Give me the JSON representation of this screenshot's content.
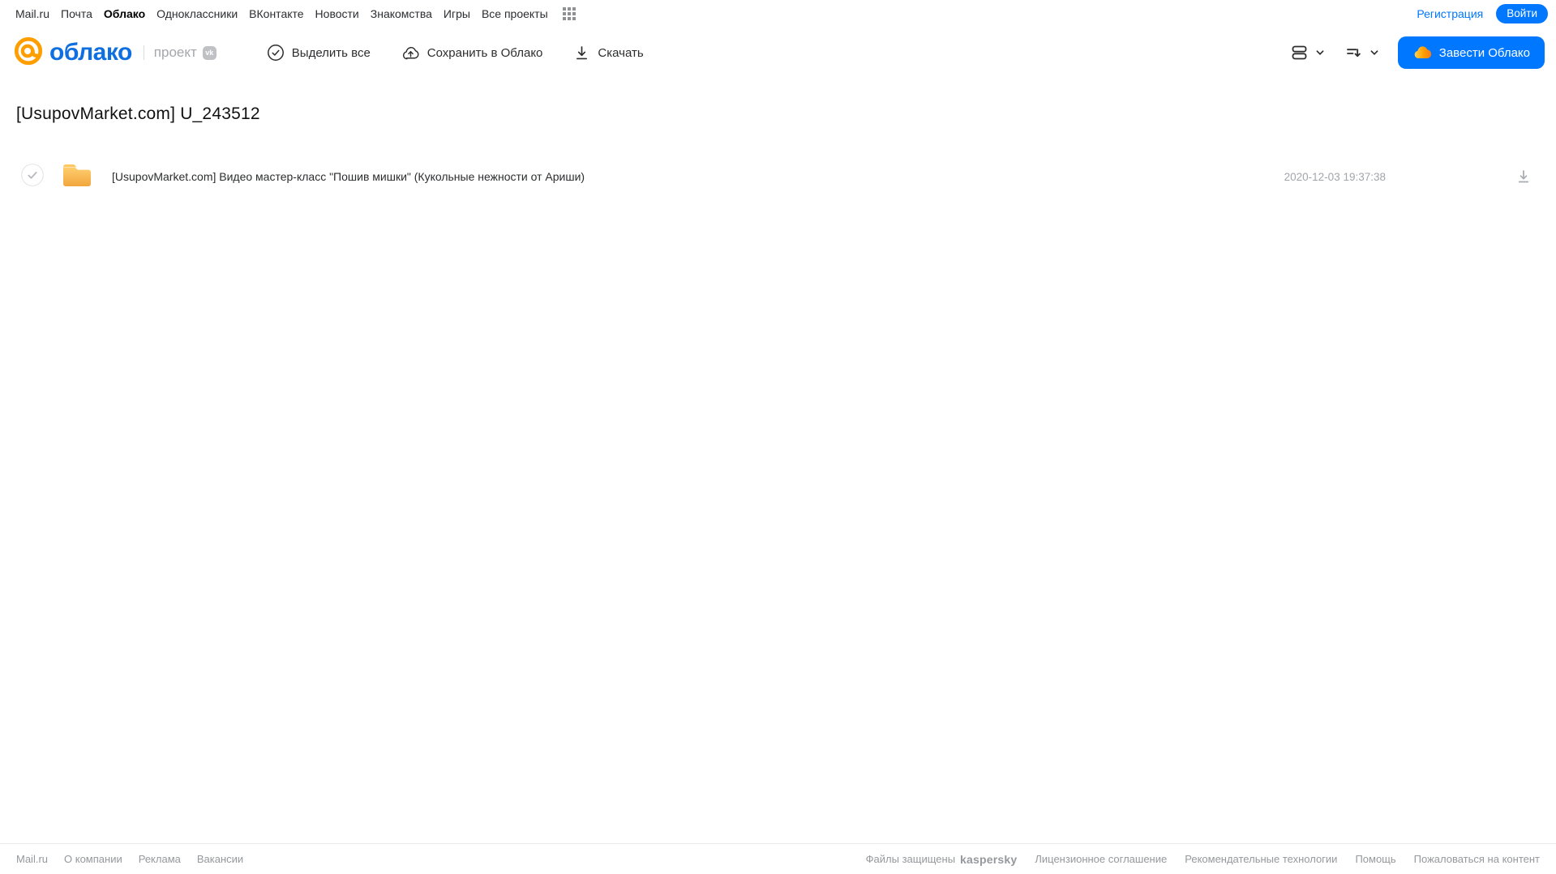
{
  "topnav": {
    "items": [
      "Mail.ru",
      "Почта",
      "Облако",
      "Одноклассники",
      "ВКонтакте",
      "Новости",
      "Знакомства",
      "Игры",
      "Все проекты"
    ],
    "registration": "Регистрация",
    "login": "Войти"
  },
  "header": {
    "logo_text": "облако",
    "project_label": "проект",
    "vk_badge": "vk",
    "select_all": "Выделить все",
    "save_to_cloud": "Сохранить в Облако",
    "download": "Скачать",
    "create_cloud": "Завести Облако"
  },
  "main": {
    "title": "[UsupovMarket.com] U_243512",
    "file": {
      "type": "folder",
      "name": "[UsupovMarket.com] Видео мастер-класс \"Пошив мишки\" (Кукольные нежности от Ариши)",
      "date": "2020-12-03 19:37:38"
    }
  },
  "footer": {
    "left_links": [
      "Mail.ru",
      "О компании",
      "Реклама",
      "Вакансии"
    ],
    "protected_label": "Файлы защищены",
    "kaspersky": "kaspersky",
    "right_links": [
      "Лицензионное соглашение",
      "Рекомендательные технологии",
      "Помощь",
      "Пожаловаться на контент"
    ]
  },
  "colors": {
    "accent_blue": "#0077ff",
    "brand_orange": "#ff9e00",
    "folder_top": "#ffcd6e",
    "folder_bottom": "#f2a63c",
    "kaspersky_green": "#006d5c",
    "text_dark": "#2c2d2e",
    "text_muted": "#a2a5aa"
  }
}
